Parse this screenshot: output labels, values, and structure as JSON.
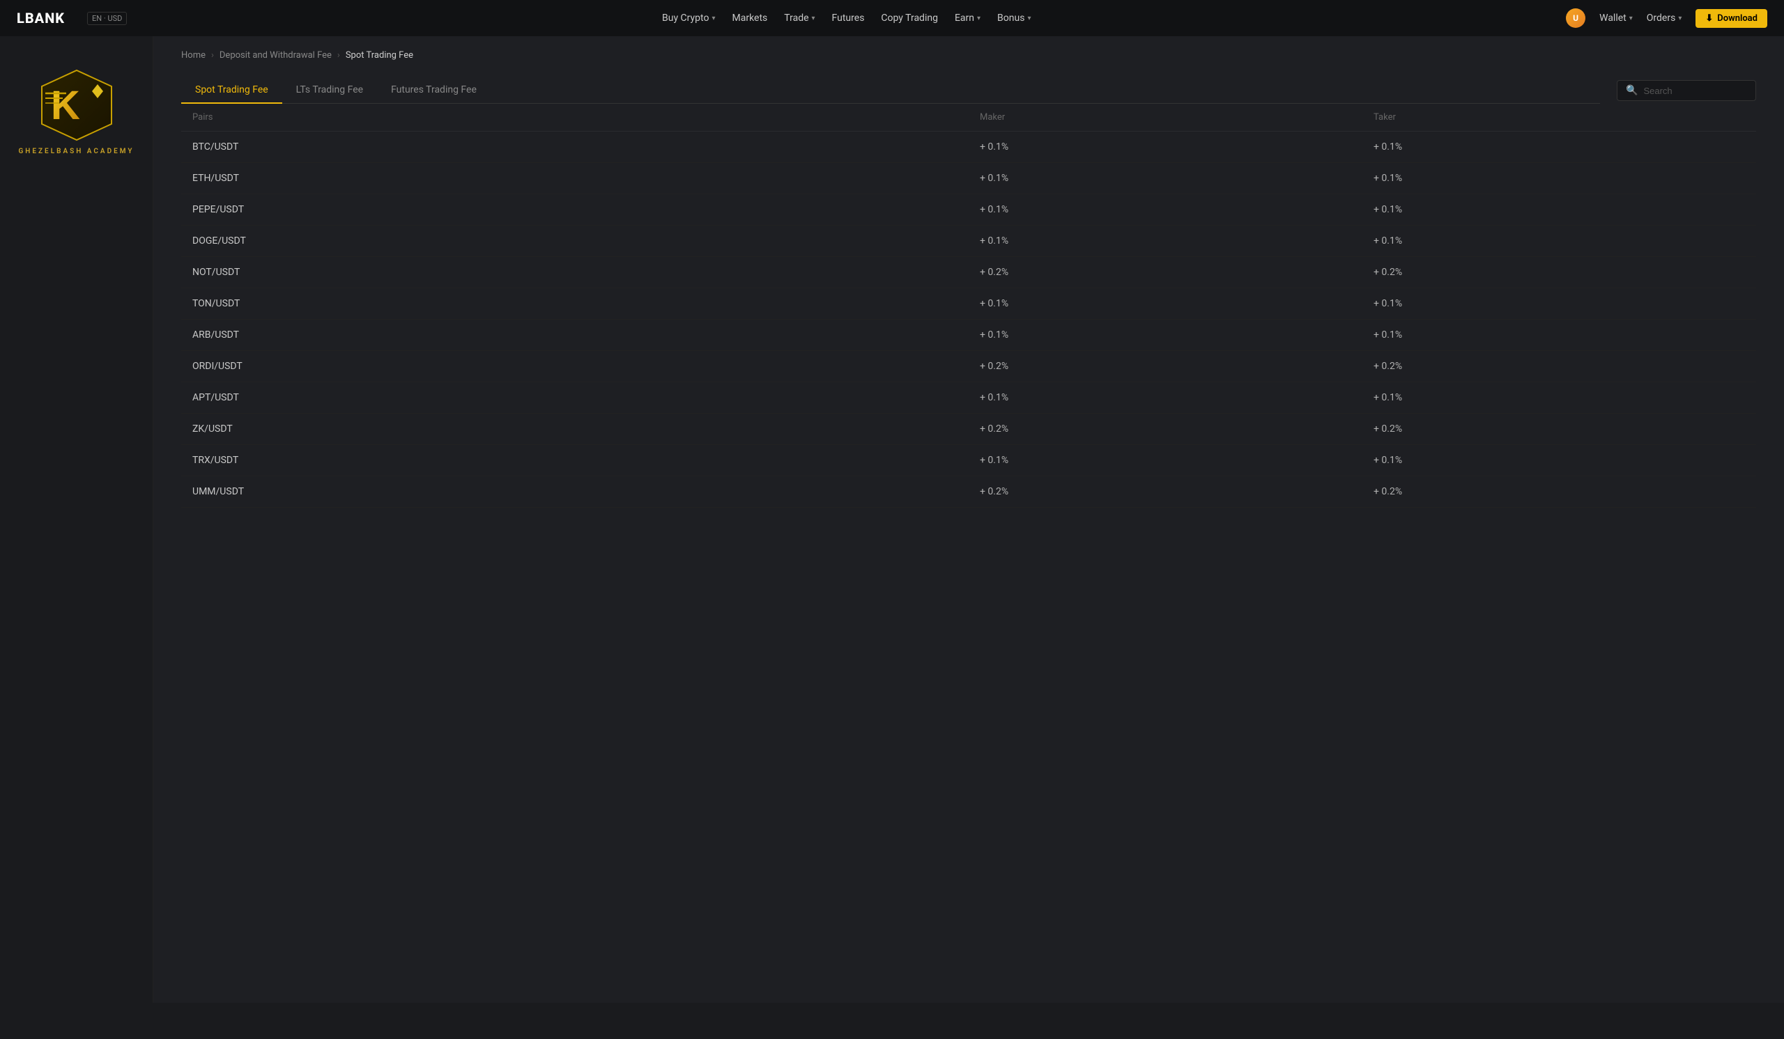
{
  "navbar": {
    "logo": "LBANK",
    "locale": "EN · USD",
    "nav_items": [
      {
        "label": "Buy Crypto",
        "has_dropdown": true
      },
      {
        "label": "Markets",
        "has_dropdown": false
      },
      {
        "label": "Trade",
        "has_dropdown": true
      },
      {
        "label": "Futures",
        "has_dropdown": false
      },
      {
        "label": "Copy Trading",
        "has_dropdown": false
      },
      {
        "label": "Earn",
        "has_dropdown": true
      },
      {
        "label": "Bonus",
        "has_dropdown": true
      }
    ],
    "wallet_label": "Wallet",
    "orders_label": "Orders",
    "download_label": "Download"
  },
  "breadcrumb": {
    "home": "Home",
    "parent": "Deposit and Withdrawal Fee",
    "current": "Spot Trading Fee"
  },
  "tabs": [
    {
      "label": "Spot Trading Fee",
      "active": true
    },
    {
      "label": "LTs Trading Fee",
      "active": false
    },
    {
      "label": "Futures Trading Fee",
      "active": false
    }
  ],
  "search": {
    "placeholder": "Search"
  },
  "table": {
    "columns": [
      "Pairs",
      "Maker",
      "Taker"
    ],
    "rows": [
      {
        "pair": "BTC/USDT",
        "maker": "+ 0.1%",
        "taker": "+ 0.1%"
      },
      {
        "pair": "ETH/USDT",
        "maker": "+ 0.1%",
        "taker": "+ 0.1%"
      },
      {
        "pair": "PEPE/USDT",
        "maker": "+ 0.1%",
        "taker": "+ 0.1%"
      },
      {
        "pair": "DOGE/USDT",
        "maker": "+ 0.1%",
        "taker": "+ 0.1%"
      },
      {
        "pair": "NOT/USDT",
        "maker": "+ 0.2%",
        "taker": "+ 0.2%"
      },
      {
        "pair": "TON/USDT",
        "maker": "+ 0.1%",
        "taker": "+ 0.1%"
      },
      {
        "pair": "ARB/USDT",
        "maker": "+ 0.1%",
        "taker": "+ 0.1%"
      },
      {
        "pair": "ORDI/USDT",
        "maker": "+ 0.2%",
        "taker": "+ 0.2%"
      },
      {
        "pair": "APT/USDT",
        "maker": "+ 0.1%",
        "taker": "+ 0.1%"
      },
      {
        "pair": "ZK/USDT",
        "maker": "+ 0.2%",
        "taker": "+ 0.2%"
      },
      {
        "pair": "TRX/USDT",
        "maker": "+ 0.1%",
        "taker": "+ 0.1%"
      },
      {
        "pair": "UMM/USDT",
        "maker": "+ 0.2%",
        "taker": "+ 0.2%"
      }
    ]
  },
  "sidebar": {
    "logo_text": "GHEZELBASH  ACADEMY"
  }
}
